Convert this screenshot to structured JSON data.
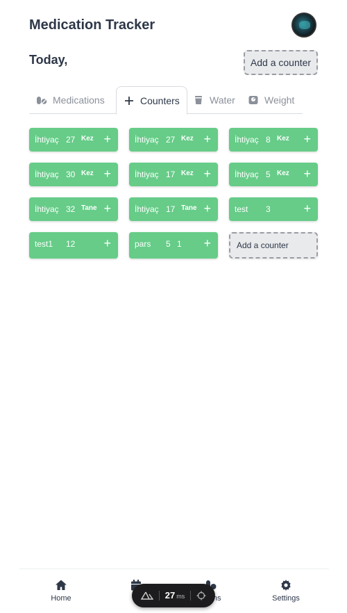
{
  "header": {
    "title": "Medication Tracker"
  },
  "today": {
    "label": "Today,",
    "add_counter_label": "Add a counter"
  },
  "tabs": [
    {
      "label": "Medications",
      "icon": "pills-icon"
    },
    {
      "label": "Counters",
      "icon": "plus-icon"
    },
    {
      "label": "Water",
      "icon": "cup-icon"
    },
    {
      "label": "Weight",
      "icon": "scale-icon"
    }
  ],
  "counters": [
    {
      "name": "İhtiyaç",
      "count": "27",
      "unit": "Kez"
    },
    {
      "name": "İhtiyaç",
      "count": "27",
      "unit": "Kez"
    },
    {
      "name": "İhtiyaç",
      "count": "8",
      "unit": "Kez"
    },
    {
      "name": "İhtiyaç",
      "count": "30",
      "unit": "Kez"
    },
    {
      "name": "İhtiyaç",
      "count": "17",
      "unit": "Kez"
    },
    {
      "name": "İhtiyaç",
      "count": "5",
      "unit": "Kez"
    },
    {
      "name": "İhtiyaç",
      "count": "32",
      "unit": "Tane"
    },
    {
      "name": "İhtiyaç",
      "count": "17",
      "unit": "Tane"
    },
    {
      "name": "test",
      "count": "3",
      "unit": ""
    },
    {
      "name": "test1",
      "count": "12",
      "unit": ""
    },
    {
      "name": "pars",
      "count": "5",
      "unit": "1"
    }
  ],
  "grid_add_label": "Add a counter",
  "plus_symbol": "+",
  "nav": [
    {
      "label": "Home",
      "icon": "home-icon"
    },
    {
      "label": "Hi",
      "icon": "calendar-icon"
    },
    {
      "label": "ations",
      "icon": "pills-icon"
    },
    {
      "label": "Settings",
      "icon": "gear-icon"
    }
  ],
  "perf": {
    "value": "27",
    "unit": "ms"
  },
  "colors": {
    "counter_green": "#66cc88",
    "text_dark": "#2d3748",
    "tab_inactive": "#8b909a"
  }
}
